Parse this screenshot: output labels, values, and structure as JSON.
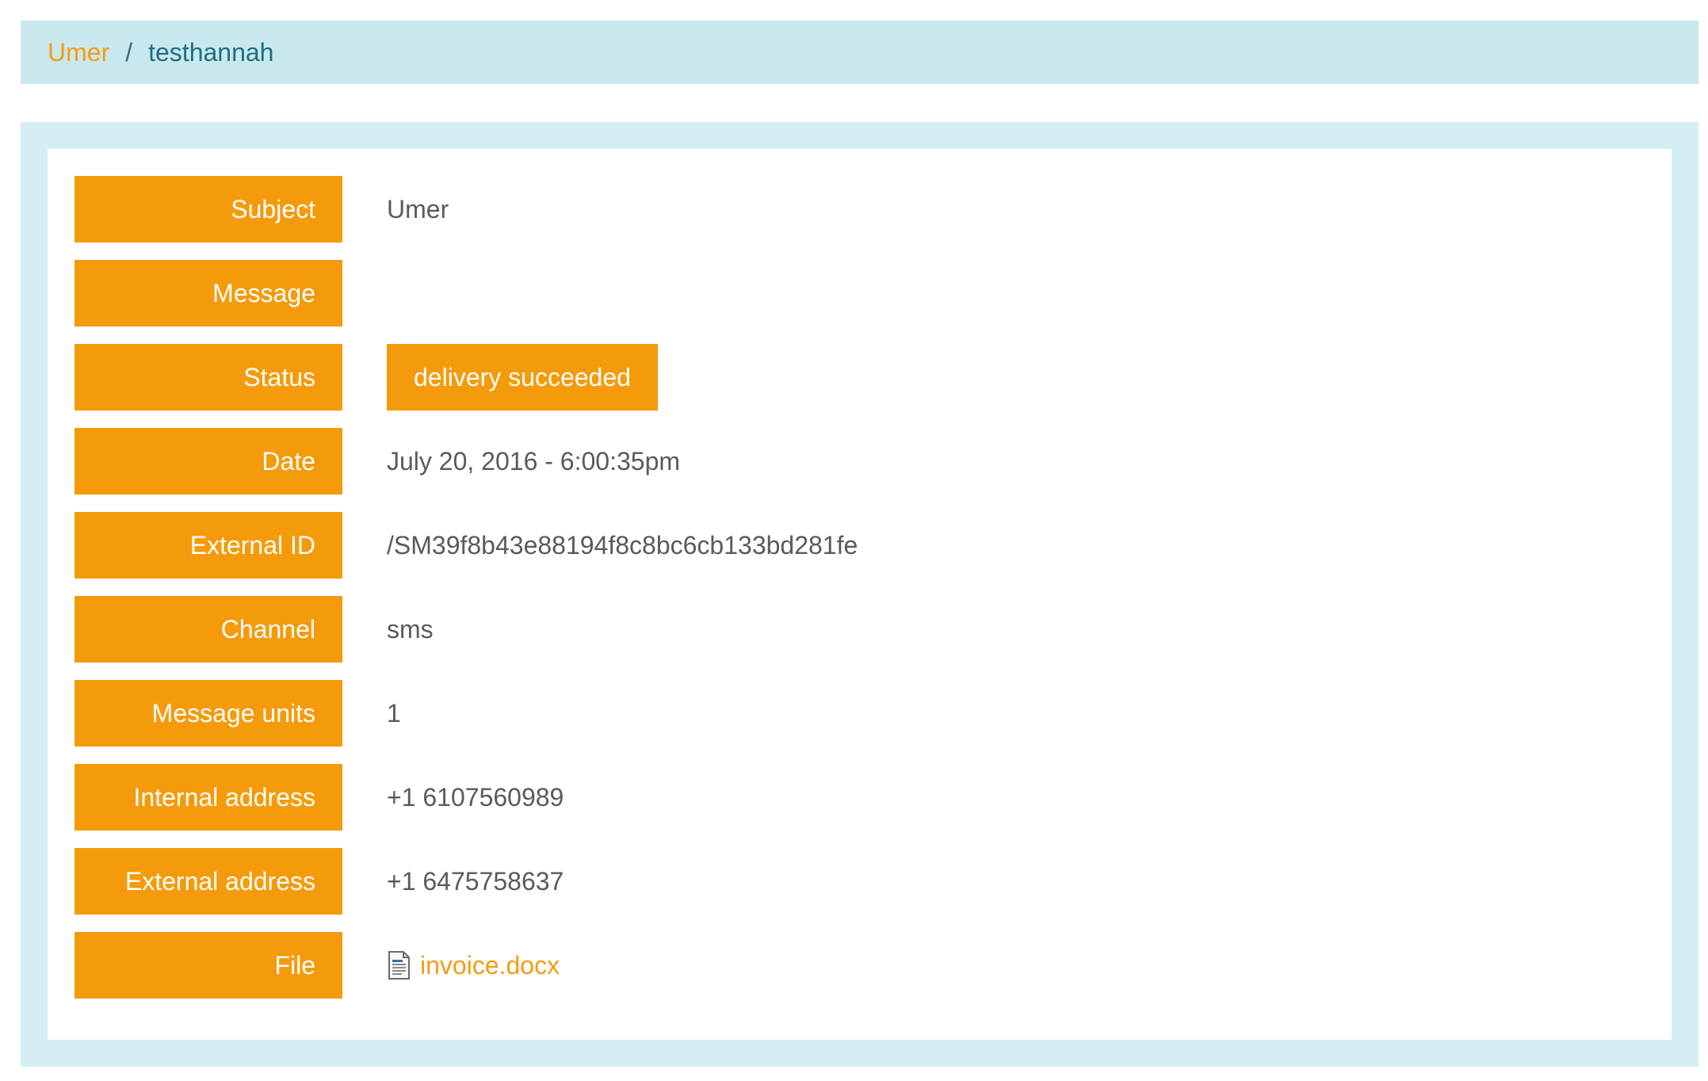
{
  "breadcrumb": {
    "parent": "Umer",
    "separator": "/",
    "current": "testhannah"
  },
  "details": {
    "subject": {
      "label": "Subject",
      "value": "Umer"
    },
    "message": {
      "label": "Message",
      "value": ""
    },
    "status": {
      "label": "Status",
      "value": "delivery succeeded"
    },
    "date": {
      "label": "Date",
      "value": "July 20, 2016 - 6:00:35pm"
    },
    "external_id": {
      "label": "External ID",
      "value": "/SM39f8b43e88194f8c8bc6cb133bd281fe"
    },
    "channel": {
      "label": "Channel",
      "value": "sms"
    },
    "message_units": {
      "label": "Message units",
      "value": "1"
    },
    "internal_address": {
      "label": "Internal address",
      "value": "+1 6107560989"
    },
    "external_address": {
      "label": "External address",
      "value": "+1 6475758637"
    },
    "file": {
      "label": "File",
      "value": "invoice.docx",
      "icon": "document-icon"
    }
  },
  "colors": {
    "accent": "#f59b0b",
    "breadcrumb_bg": "#c9e8ee",
    "panel_bg": "#d4eef3",
    "text": "#5a5a5a"
  }
}
